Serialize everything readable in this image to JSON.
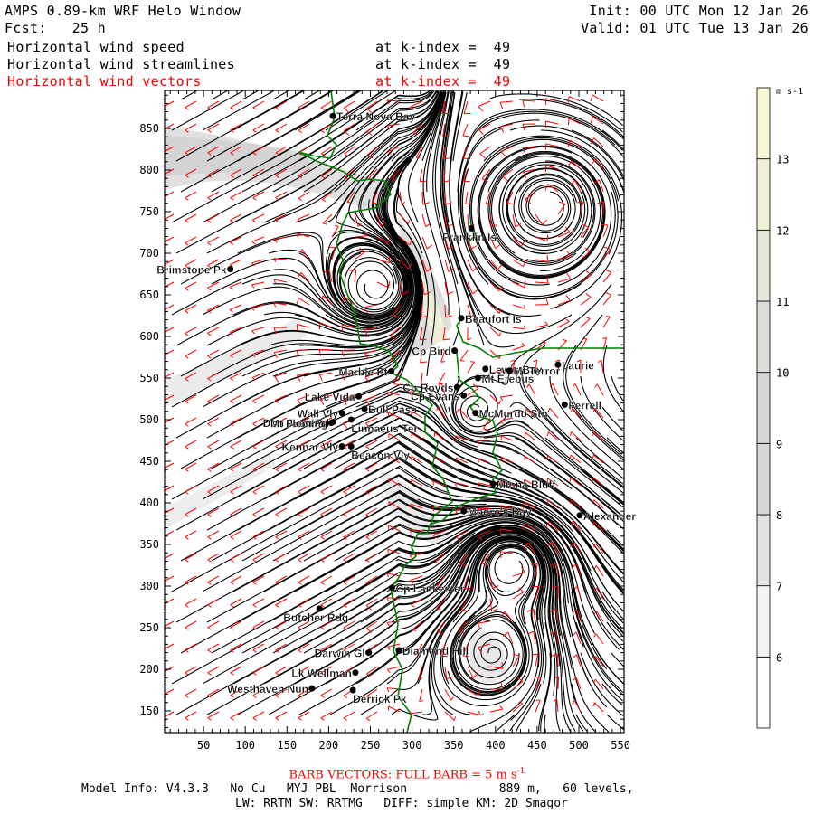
{
  "header": {
    "title": "AMPS 0.89-km WRF Helo Window",
    "fcst_label": "Fcst:",
    "fcst_value": "25 h",
    "init": "Init: 00 UTC Mon 12 Jan 26",
    "valid": "Valid: 01 UTC Tue 13 Jan 26"
  },
  "fields": [
    {
      "name": "Horizontal wind speed",
      "level": "at k-index =  49",
      "color": "#000000"
    },
    {
      "name": "Horizontal wind streamlines",
      "level": "at k-index =  49",
      "color": "#000000"
    },
    {
      "name": "Horizontal wind vectors",
      "level": "at k-index =  49",
      "color": "#ff0000"
    }
  ],
  "chart_data": {
    "type": "map",
    "x_ticks": [
      50,
      100,
      150,
      200,
      250,
      300,
      350,
      400,
      450,
      500,
      550
    ],
    "y_ticks": [
      150,
      200,
      250,
      300,
      350,
      400,
      450,
      500,
      550,
      600,
      650,
      700,
      750,
      800,
      850
    ],
    "xlim": [
      0,
      555
    ],
    "ylim": [
      125,
      895
    ],
    "colorbar": {
      "units": "m s-1",
      "levels": [
        6,
        7,
        8,
        9,
        10,
        11,
        12,
        13
      ],
      "colors": [
        "#ffffff",
        "#f3f3f3",
        "#e2e2e2",
        "#d6d6d6",
        "#d6d6d6",
        "#dcdcd8",
        "#e6e6d6",
        "#f0f0d6",
        "#f8f8d4"
      ]
    },
    "stations": [
      {
        "name": "Terra Nova Bay",
        "x": 205,
        "y": 865
      },
      {
        "name": "Franklin Is",
        "x": 371,
        "y": 730
      },
      {
        "name": "Brimstone Pk",
        "x": 82,
        "y": 681
      },
      {
        "name": "Beaufort Is",
        "x": 359,
        "y": 622
      },
      {
        "name": "Cp Bird",
        "x": 351,
        "y": 583
      },
      {
        "name": "Marble Pt",
        "x": 275,
        "y": 558
      },
      {
        "name": "Cp Royds",
        "x": 354,
        "y": 539
      },
      {
        "name": "Cp Evans",
        "x": 362,
        "y": 529
      },
      {
        "name": "Lewis Bay",
        "x": 388,
        "y": 561
      },
      {
        "name": "Mt Terror",
        "x": 417,
        "y": 559
      },
      {
        "name": "Laurie",
        "x": 475,
        "y": 566
      },
      {
        "name": "Mt Erebus",
        "x": 379,
        "y": 550
      },
      {
        "name": "McMurdo Stn",
        "x": 376,
        "y": 508
      },
      {
        "name": "Ferrell",
        "x": 483,
        "y": 518
      },
      {
        "name": "Lake Vida",
        "x": 236,
        "y": 528
      },
      {
        "name": "Wall Vly",
        "x": 216,
        "y": 508
      },
      {
        "name": "Don Juan Pd",
        "x": 205,
        "y": 497
      },
      {
        "name": "Bull Pass",
        "x": 243,
        "y": 513
      },
      {
        "name": "Mt Fleming",
        "x": 203,
        "y": 496
      },
      {
        "name": "Linnaeus Ter",
        "x": 227,
        "y": 500
      },
      {
        "name": "Kennar Vly",
        "x": 216,
        "y": 468
      },
      {
        "name": "Beacon Vly",
        "x": 227,
        "y": 468
      },
      {
        "name": "Minna Bluff",
        "x": 397,
        "y": 423
      },
      {
        "name": "Moore's Bay",
        "x": 362,
        "y": 390
      },
      {
        "name": "Alexander",
        "x": 501,
        "y": 385
      },
      {
        "name": "Cp Lankester",
        "x": 276,
        "y": 298
      },
      {
        "name": "Butcher Rdg",
        "x": 189,
        "y": 273
      },
      {
        "name": "Darwin Gl",
        "x": 248,
        "y": 220
      },
      {
        "name": "Diamond Hill",
        "x": 284,
        "y": 223
      },
      {
        "name": "Lk Wellman",
        "x": 232,
        "y": 196
      },
      {
        "name": "Westhaven Nun",
        "x": 180,
        "y": 177
      },
      {
        "name": "Derrick Pk",
        "x": 229,
        "y": 175
      }
    ]
  },
  "footer": {
    "barb_label": "BARB VECTORS:  FULL BARB = 5 m s",
    "barb_exp": "-1",
    "model_info": "Model Info: V4.3.3   No Cu   MYJ PBL  Morrison             889 m,   60 levels,",
    "physics": "LW: RRTM SW: RRTMG   DIFF: simple KM: 2D Smagor"
  }
}
